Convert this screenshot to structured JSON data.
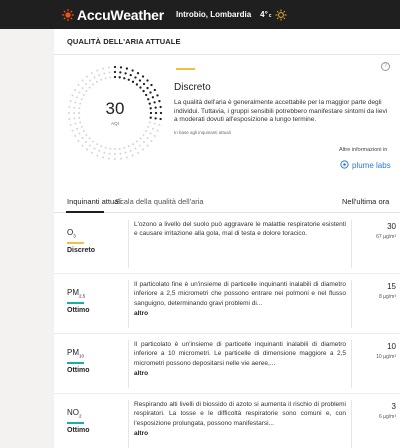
{
  "header": {
    "brand": "AccuWeather",
    "location": "Introbio, Lombardia",
    "temperature": "4°",
    "temp_unit": "c",
    "weather_icon": "sun-icon"
  },
  "current": {
    "section_title": "QUALITÀ DELL'ARIA ATTUALE",
    "aqi_value": "30",
    "aqi_label": "AQI",
    "status": "Discreto",
    "status_color": "#f0c23a",
    "description": "La qualità dell'aria è generalmente accettabile per la maggior parte degli individui. Tuttavia, i gruppi sensibili potrebbero manifestare sintomi da lievi a moderati dovuti all'esposizione a lungo termine.",
    "basis": "In base agli inquinanti attuali",
    "more_info": "Altre informazioni in",
    "provider": "plume labs",
    "help_icon": "?"
  },
  "pollutants": {
    "tabs": [
      "Inquinanti attuali",
      "Scala della qualità dell'aria",
      "Nell'ultima ora"
    ],
    "more_label": "altro",
    "rows": [
      {
        "name": "O",
        "sub": "3",
        "level": "Discreto",
        "level_color": "#f0c23a",
        "description": "L'ozono a livello del suolo può aggravare le malattie respiratorie esistenti e causare irritazione alla gola, mal di testa e dolore toracico.",
        "value": "30",
        "unit": "67 µg/m³"
      },
      {
        "name": "PM",
        "sub": "2.5",
        "level": "Ottimo",
        "level_color": "#16b1a6",
        "description": "Il particolato fine è un'insieme di particelle inquinanti inalabili di diametro inferiore a 2,5 micrometri che possono entrare nei polmoni e nel flusso sanguigno, determinando gravi problemi di...",
        "value": "15",
        "unit": "8 µg/m³"
      },
      {
        "name": "PM",
        "sub": "10",
        "level": "Ottimo",
        "level_color": "#16b1a6",
        "description": "Il particolato è un'insieme di particelle inquinanti inalabili di diametro inferiore a 10 micrometri. Le particelle di dimensione maggiore a 2,5 micrometri possono depositarsi nelle vie aeree,...",
        "value": "10",
        "unit": "10 µg/m³"
      },
      {
        "name": "NO",
        "sub": "2",
        "level": "Ottimo",
        "level_color": "#16b1a6",
        "description": "Respirando alti livelli di biossido di azoto si aumenta il rischio di problemi respiratori. La tosse e le difficoltà respiratorie sono comuni e, con l'esposizione prolungata, possono manifestarsi...",
        "value": "3",
        "unit": "6 µg/m³"
      }
    ]
  }
}
